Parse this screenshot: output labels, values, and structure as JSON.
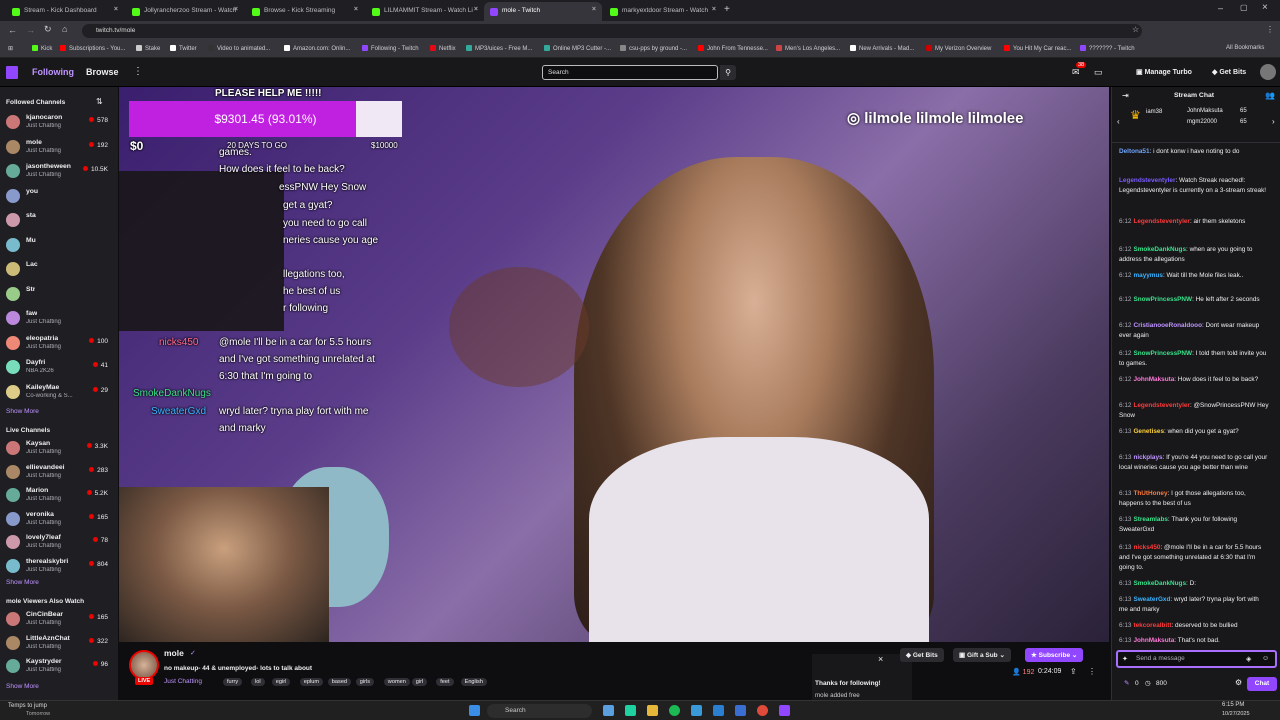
{
  "browser": {
    "tabs": [
      "Stream - Kick Dashboard",
      "Jollyrancherzoo Stream - Watch",
      "Browse - Kick Streaming",
      "LILMAMMIT Stream - Watch Li",
      "mole - Twitch",
      "markyextdoor Stream - Watch"
    ],
    "url": "twitch.tv/mole",
    "bookmarks": [
      "Kick",
      "Subscriptions - You...",
      "Stake",
      "Twitter",
      "Video to animated...",
      "Amazon.com: Onlin...",
      "Following - Twitch",
      "Netflix",
      "MP3/uices - Free M...",
      "Online MP3 Cutter -...",
      "csu-pps by ground -...",
      "John From Tennesse...",
      "Men's Los Angeles...",
      "New Arrivals - Mad...",
      "My Verizon Overview",
      "You Hit My Car reac...",
      "??????? - Twitch"
    ],
    "all_bookmarks": "All Bookmarks"
  },
  "nav": {
    "following": "Following",
    "browse": "Browse",
    "search_placeholder": "Search",
    "notif_count": "38",
    "manage_turbo": "Manage Turbo",
    "get_bits": "Get Bits"
  },
  "sidebar": {
    "followed_header": "Followed Channels",
    "followed": [
      {
        "name": "kjanocaron",
        "game": "Just Chatting",
        "viewers": "578"
      },
      {
        "name": "mole",
        "game": "Just Chatting",
        "viewers": "192"
      },
      {
        "name": "jasontheween",
        "game": "Just Chatting",
        "viewers": "10.5K"
      },
      {
        "name": "you",
        "game": "",
        "viewers": ""
      },
      {
        "name": "sta",
        "game": "",
        "viewers": ""
      },
      {
        "name": "Mu",
        "game": "",
        "viewers": ""
      },
      {
        "name": "Lac",
        "game": "",
        "viewers": ""
      },
      {
        "name": "Str",
        "game": "",
        "viewers": ""
      },
      {
        "name": "faw",
        "game": "Just Chatting",
        "viewers": ""
      },
      {
        "name": "eleopatria",
        "game": "Just Chatting",
        "viewers": "100"
      },
      {
        "name": "Dayfri",
        "game": "NBA 2K26",
        "viewers": "41"
      },
      {
        "name": "KaileyMae",
        "game": "Co-working & S...",
        "viewers": "29"
      }
    ],
    "show_more": "Show More",
    "live_header": "Live Channels",
    "live": [
      {
        "name": "Kaysan",
        "game": "Just Chatting",
        "viewers": "3.3K"
      },
      {
        "name": "ellievandeei",
        "game": "Just Chatting",
        "viewers": "283"
      },
      {
        "name": "Marion",
        "game": "Just Chatting",
        "viewers": "5.2K"
      },
      {
        "name": "veronika",
        "game": "Just Chatting",
        "viewers": "165"
      },
      {
        "name": "lovely7leaf",
        "game": "Just Chatting",
        "viewers": "78"
      },
      {
        "name": "therealskybri",
        "game": "Just Chatting",
        "viewers": "804"
      }
    ],
    "also_header": "mole Viewers Also Watch",
    "also": [
      {
        "name": "CinCinBear",
        "game": "Just Chatting",
        "viewers": "165"
      },
      {
        "name": "LittleAznChat",
        "game": "Just Chatting",
        "viewers": "322"
      },
      {
        "name": "Kaystryder",
        "game": "Just Chatting",
        "viewers": "96"
      }
    ]
  },
  "video": {
    "goal_title": "PLEASE HELP ME !!!!!",
    "goal_amount": "$9301.45 (93.01%)",
    "goal_fraction": 0.9301,
    "goal_min": "$0",
    "goal_days": "20 DAYS TO GO",
    "goal_max": "$10000",
    "socials": "lilmole  lilmole  lilmolee",
    "overlay_lines": [
      "games.",
      "How does it feel to be back?",
      "essPNW Hey Snow",
      "get a gyat?",
      "you need to go call",
      "neries cause you age",
      "llegations too,",
      "he best of us",
      "r following",
      "@mole I'll be in a car for 5.5 hours",
      "and I've got something unrelated at",
      "6:30 that I'm going to",
      "wryd later? tryna play fort with me",
      "and marky"
    ],
    "overlay_names": [
      "nicks450",
      "SmokeDankNugs",
      "SweaterGxd"
    ]
  },
  "stream": {
    "channel": "mole",
    "title": "no makeup- 44 & unemployed- lots to talk about",
    "category": "Just Chatting",
    "tags": [
      "furry",
      "lol",
      "egirl",
      "eplum",
      "based",
      "girls",
      "women",
      "girl",
      "feet",
      "English"
    ],
    "live": "LIVE",
    "viewers": "192",
    "uptime": "0:24:09",
    "get_bits": "Get Bits",
    "gift_sub": "Gift a Sub",
    "subscribe": "Subscribe",
    "toast_title": "Thanks for following!",
    "toast_body": "mole added free"
  },
  "chat": {
    "header": "Stream Chat",
    "leaders": [
      "iam38",
      "JohnMaksuta",
      "mgm22000"
    ],
    "leader_counts": [
      "65",
      "65"
    ],
    "messages": [
      {
        "t": "",
        "u": "Deltona51",
        "c": "#6ea6ff",
        "m": "i dont konw i have noting to do"
      },
      {
        "t": "",
        "u": "Legendsteventyler",
        "c": "#7a5cff",
        "m": "Watch Streak reached!: Legendsteventyler is currently on a 3-stream streak!"
      },
      {
        "t": "6:12",
        "u": "Legendsteventyler",
        "c": "#ff3a3a",
        "m": "air them skeletons"
      },
      {
        "t": "6:12",
        "u": "SmokeDankNugs",
        "c": "#38e38a",
        "m": "when are you going to address the allegations"
      },
      {
        "t": "6:12",
        "u": "mayymus",
        "c": "#3ab3ff",
        "m": "Wait till the Mole files leak.."
      },
      {
        "t": "6:12",
        "u": "SnowPrincessPNW",
        "c": "#38e38a",
        "m": "He left after 2 seconds"
      },
      {
        "t": "6:12",
        "u": "CristianooeRonaldooo",
        "c": "#bf94ff",
        "m": "Dont wear makeup ever again"
      },
      {
        "t": "6:12",
        "u": "SnowPrincessPNW",
        "c": "#38e38a",
        "m": "I told them told invite you to games."
      },
      {
        "t": "6:12",
        "u": "JohnMaksuta",
        "c": "#ff7ad9",
        "m": "How does it feel to be back?"
      },
      {
        "t": "6:12",
        "u": "Legendsteventyler",
        "c": "#ff3a3a",
        "m": "@SnowPrincessPNW Hey Snow"
      },
      {
        "t": "6:13",
        "u": "Genetises",
        "c": "#ffd23a",
        "m": "when did you get a gyat?"
      },
      {
        "t": "6:13",
        "u": "nickplays",
        "c": "#bf94ff",
        "m": "If you're 44 you need to go call your local wineries cause you age better than wine"
      },
      {
        "t": "6:13",
        "u": "ThUtHoney",
        "c": "#ff7a3a",
        "m": "I got those allegations too, happens to the best of us"
      },
      {
        "t": "6:13",
        "u": "Streamlabs",
        "c": "#38e38a",
        "m": "Thank you for following SweaterGxd"
      },
      {
        "t": "6:13",
        "u": "nicks450",
        "c": "#ff3a3a",
        "m": "@mole I'll be in a car for 5.5 hours and I've got something unrelated at 6:30 that I'm going to."
      },
      {
        "t": "6:13",
        "u": "SmokeDankNugs",
        "c": "#38e38a",
        "m": "D:"
      },
      {
        "t": "6:13",
        "u": "SweaterGxd",
        "c": "#3ab3ff",
        "m": "wryd later? tryna play fort with me and marky"
      },
      {
        "t": "6:13",
        "u": "tekcorealbitt",
        "c": "#ff3a3a",
        "m": "deserved to be bullied"
      },
      {
        "t": "6:13",
        "u": "JohnMaksuta",
        "c": "#ff7ad9",
        "m": "That's not bad."
      }
    ],
    "input_placeholder": "Send a message",
    "points": "0",
    "bits": "800",
    "send": "Chat"
  },
  "taskbar": {
    "weather": "Temps to jump",
    "weather_sub": "Tomorrow",
    "search": "Search",
    "time": "6:15 PM",
    "date": "10/27/2025"
  }
}
